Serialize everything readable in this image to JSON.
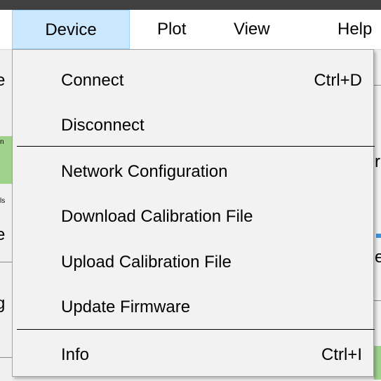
{
  "menubar": {
    "menus": [
      {
        "label": "Device"
      },
      {
        "label": "Plot"
      },
      {
        "label": "View"
      },
      {
        "label": "Help"
      }
    ]
  },
  "device_menu": {
    "items": [
      {
        "label": "Connect",
        "shortcut": "Ctrl+D"
      },
      {
        "label": "Disconnect",
        "shortcut": ""
      },
      {
        "label": "Network Configuration",
        "shortcut": ""
      },
      {
        "label": "Download Calibration File",
        "shortcut": ""
      },
      {
        "label": "Upload Calibration File",
        "shortcut": ""
      },
      {
        "label": "Update Firmware",
        "shortcut": ""
      },
      {
        "label": "Info",
        "shortcut": "Ctrl+I"
      }
    ]
  },
  "background": {
    "left_fragments": [
      "e",
      "n",
      "ls",
      "e",
      "g"
    ],
    "right_fragments": [
      "r",
      "e"
    ]
  },
  "colors": {
    "menubar_bg": "#ffffff",
    "open_menu_highlight": "#cce8ff",
    "dropdown_bg": "#f2f2f2",
    "separator": "#000000",
    "background_green": "#9ed28a"
  }
}
